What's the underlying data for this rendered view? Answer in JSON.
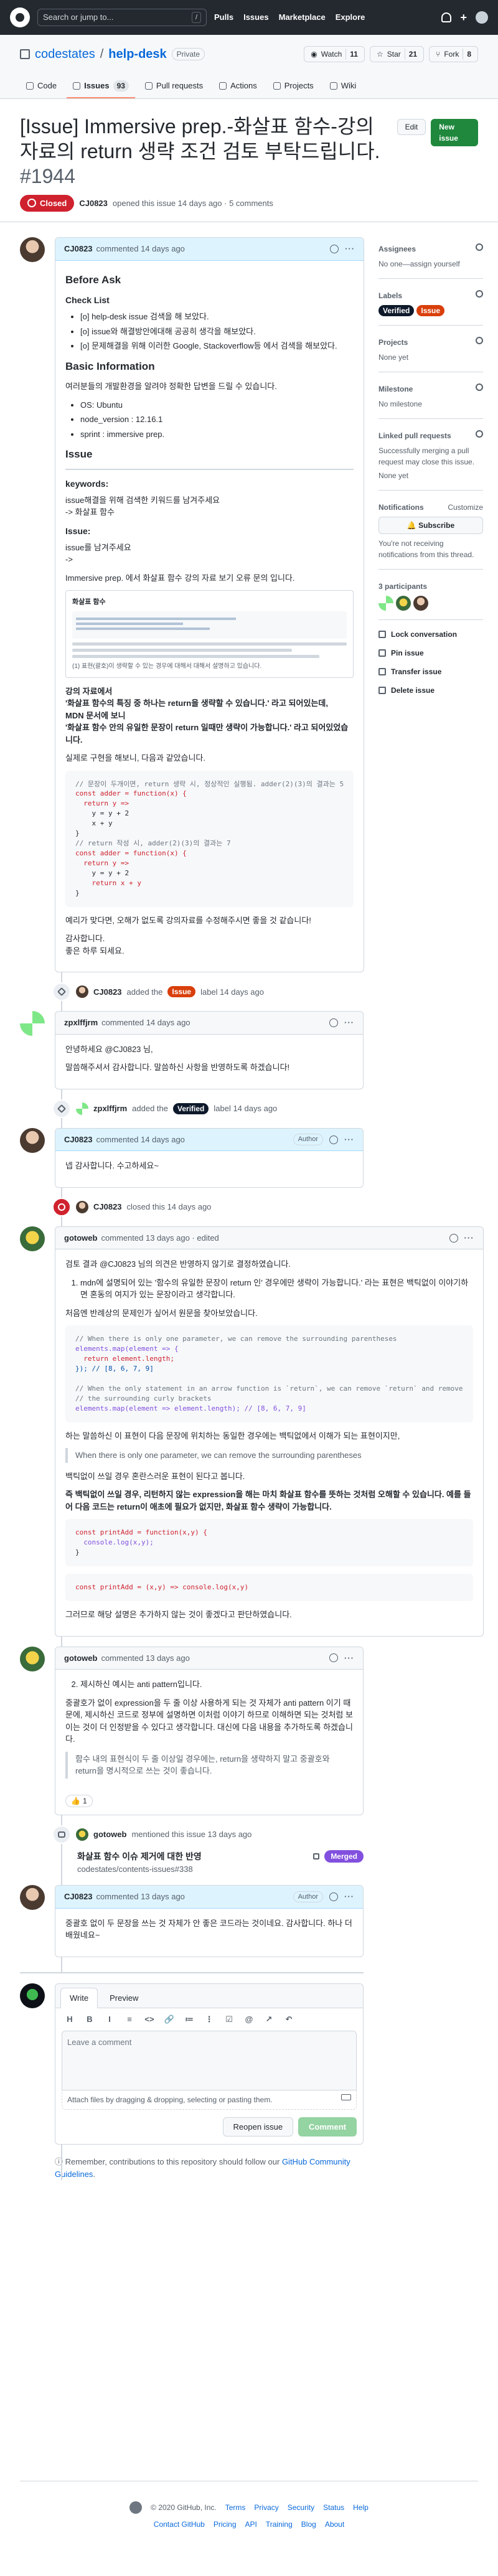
{
  "nav": {
    "search_placeholder": "Search or jump to...",
    "search_shortcut": "/",
    "links": [
      "Pulls",
      "Issues",
      "Marketplace",
      "Explore"
    ],
    "plus": "+"
  },
  "repo": {
    "owner": "codestates",
    "separator": "/",
    "name": "help-desk",
    "visibility": "Private",
    "watch_label": "Watch",
    "watch_count": "11",
    "star_label": "Star",
    "star_count": "21",
    "fork_label": "Fork",
    "fork_count": "8",
    "tabs": [
      {
        "label": "Code"
      },
      {
        "label": "Issues",
        "count": "93"
      },
      {
        "label": "Pull requests"
      },
      {
        "label": "Actions"
      },
      {
        "label": "Projects"
      },
      {
        "label": "Wiki"
      }
    ]
  },
  "issue": {
    "title": "[Issue] Immersive prep.-화살표 함수-강의자료의 return 생략 조건 검토 부탁드립니다.",
    "number": "#1944",
    "edit_label": "Edit",
    "new_issue_label": "New issue",
    "state": "Closed",
    "author": "CJ0823",
    "meta_text": "opened this issue 14 days ago · 5 comments"
  },
  "comments": {
    "c1": {
      "author": "CJ0823",
      "time": "commented 14 days ago",
      "before_ask": "Before Ask",
      "checklist_title": "Check List",
      "checklist": [
        "[o] help-desk issue 검색을 해 보았다.",
        "[o] issue와 해결방안에대해 공공히 생각을 해보았다.",
        "[o] 문제해결을 위해 이러한 Google, Stackoverflow등 에서 검색을 해보았다."
      ],
      "basic_info_title": "Basic Information",
      "basic_info_desc": "여러분들의 개발환경을 알려야 정확한 답변을 드릴 수 있습니다.",
      "basic_info": [
        "OS: Ubuntu",
        "node_version : 12.16.1",
        "sprint : immersive prep."
      ],
      "issue_title": "Issue",
      "keywords_label": "keywords:",
      "keywords_desc": "issue해결을 위해 검색한 키워드를 남겨주세요",
      "keywords_value": "-> 화살표 함수",
      "issue_label": "Issue:",
      "issue_desc": "issue를 남겨주세요",
      "issue_arrow": "->",
      "issue_text": "Immersive prep. 에서 화살표 함수 강의 자료 보기 오류 문의 입니다.",
      "img_title": "화살표 함수",
      "img_caption": "(1) 표현(괄호)이 생략할 수 있는 경우에 대해서 대해서 설명하고 있습니다.",
      "lecture_title": "강의 자료에서",
      "lecture_q1": "'화살표 함수의 특징 중 하나는 return을 생략할 수 있습니다.' 라고 되어있는데,",
      "lecture_q2": "MDN 문서에 보니",
      "lecture_q3": "'화살표 함수 안의 유일한 문장이 return 일때만 생략이 가능합니다.' 라고 되어있었습니다.",
      "test_text": "실제로 구현을 해보니, 다음과 같았습니다.",
      "code": [
        "// 문장이 두개이면, return 생략 시, 정상적인 실행됨. adder(2)(3)의 결과는 5",
        "const adder = function(x) {",
        "  return y =>",
        "    y = y + 2",
        "    x + y",
        "}",
        "// return 작성 시, adder(2)(3)의 결과는 7",
        "const adder = function(x) {",
        "  return y =>",
        "    y = y + 2",
        "    return x + y",
        "}"
      ],
      "conclusion": "예리가 맞다면, 오해가 없도록 강의자료를 수정해주시면 좋을 것 같습니다!",
      "thanks": "감사합니다.",
      "goodbye": "좋은 하루 되세요."
    },
    "e1": {
      "actor": "CJ0823",
      "action": "added the",
      "label": "Issue",
      "suffix": "label 14 days ago"
    },
    "c2": {
      "author": "zpxlffjrm",
      "time": "commented 14 days ago",
      "body": "안녕하세요 @CJ0823 님,",
      "body2": "말씀해주셔서 감사합니다. 말씀하신 사항을 반영하도록 하겠습니다!"
    },
    "e2": {
      "actor": "zpxlffjrm",
      "action": "added the",
      "label": "Verified",
      "suffix": "label 14 days ago"
    },
    "c3": {
      "author": "CJ0823",
      "time": "commented 14 days ago",
      "role": "Author",
      "body": "넵 감사합니다. 수고하세요~"
    },
    "e3": {
      "actor": "CJ0823",
      "action": "closed this 14 days ago"
    },
    "c4": {
      "author": "gotoweb",
      "time": "commented 13 days ago · edited",
      "p1": "검토 결과 @CJ0823 님의 의견은 반영하지 않기로 결정하였습니다.",
      "li1": "mdn에 설명되어 있는 '함수의 유일한 문장이 return 인' 경우에만 생략이 가능합니다.' 라는 표현은 백틱없이 이야기하면 혼동의 여지가 있는 문장이라고 생각합니다.",
      "p2": "처음엔 반례상의 문제인가 싶어서 원문을 찾아보았습니다.",
      "code1": [
        "// When there is only one parameter, we can remove the surrounding parentheses",
        "elements.map(element => {",
        "  return element.length;",
        "}); // [8, 6, 7, 9]",
        "",
        "// When the only statement in an arrow function is `return`, we can remove `return` and remove",
        "// the surrounding curly brackets",
        "elements.map(element => element.length); // [8, 6, 7, 9]"
      ],
      "p3": "하는 말씀하신 이 표현이 다음 문장에 위치하는 동일한 경우에는 백틱없에서 이해가 되는 표현이지만,",
      "quote": "When there is only one parameter, we can remove the surrounding parentheses",
      "p4": "백틱없이 쓰일 경우 혼란스러운 표현이 된다고 봅니다.",
      "p5": "즉 백틱없이 쓰일 경우, 리턴하지 않는 expression을 해는 마치 화살표 함수를 뜻하는 것처럼 오해할 수 있습니다. 예를 들어 다음 코드는 return이 애초에 필요가 없지만, 화살표 함수 생략이 가능합니다.",
      "code2": [
        "const printAdd = function(x,y) {",
        "  console.log(x,y);",
        "}"
      ],
      "code3": [
        "const printAdd = (x,y) => console.log(x,y)"
      ],
      "p6": "그러므로 해당 설명은 추가하지 않는 것이 좋겠다고 판단하였습니다."
    },
    "c5": {
      "author": "gotoweb",
      "time": "commented 13 days ago",
      "li2": "제시하신 예시는 anti pattern입니다.",
      "p1": "중괄호가 없이 expression을 두 줄 이상 사용하게 되는 것 자체가 anti pattern 이기 때문에, 제시하신 코드로 정부에 설명하면 이처럼 이야기 하므로 이해하면 되는 것처럼 보이는 것이 더 인정받을 수 있다고 생각합니다. 대신에 다음 내용을 추가하도록 하겠습니다.",
      "quote": "함수 내의 표현식이 두 줄 이상일 경우에는, return을 생략하지 말고 중괄호와 return을 명시적으로 쓰는 것이 좋습니다.",
      "reaction": "1"
    },
    "x1": {
      "actor": "gotoweb",
      "action": "mentioned this issue 13 days ago",
      "title": "화살표 함수 이슈 제거에 대한 반영",
      "ref": "codestates/contents-issues#338",
      "state": "Merged"
    },
    "c6": {
      "author": "CJ0823",
      "time": "commented 13 days ago",
      "role": "Author",
      "body": "중괄호 없이 두 문장을 쓰는 것 자체가 안 좋은 코드라는 것이네요. 감사합니다. 하나 더 배웠네요~"
    }
  },
  "composer": {
    "tab_write": "Write",
    "tab_preview": "Preview",
    "toolbar": [
      "H",
      "B",
      "I",
      "≡",
      "<>",
      "🔗",
      "≔",
      "⋮",
      "☑",
      "@",
      "↗",
      "↶"
    ],
    "placeholder": "Leave a comment",
    "attach_text": "Attach files by dragging & dropping, selecting or pasting them.",
    "reopen_label": "Reopen issue",
    "comment_label": "Comment",
    "contrib_prefix": "Remember, contributions to this repository should follow our",
    "contrib_link": "GitHub Community Guidelines",
    "contrib_suffix": "."
  },
  "sidebar": {
    "assignees_title": "Assignees",
    "assignees_value": "No one—assign yourself",
    "labels_title": "Labels",
    "labels": [
      "Verified",
      "Issue"
    ],
    "projects_title": "Projects",
    "projects_value": "None yet",
    "milestone_title": "Milestone",
    "milestone_value": "No milestone",
    "linked_title": "Linked pull requests",
    "linked_desc": "Successfully merging a pull request may close this issue.",
    "linked_value": "None yet",
    "notifications_title": "Notifications",
    "customize": "Customize",
    "subscribe": "Subscribe",
    "notif_desc": "You're not receiving notifications from this thread.",
    "participants": "3 participants",
    "lock": "Lock conversation",
    "pin": "Pin issue",
    "transfer": "Transfer issue",
    "delete": "Delete issue"
  },
  "footer": {
    "copyright": "© 2020 GitHub, Inc.",
    "row1": [
      "Terms",
      "Privacy",
      "Security",
      "Status",
      "Help"
    ],
    "row2": [
      "Contact GitHub",
      "Pricing",
      "API",
      "Training",
      "Blog",
      "About"
    ]
  },
  "colors": {
    "closed": "#cf222e",
    "merged": "#8250df",
    "label_issue": "#d93f0b",
    "label_verified": "#0e1a2b",
    "link": "#0969da"
  }
}
